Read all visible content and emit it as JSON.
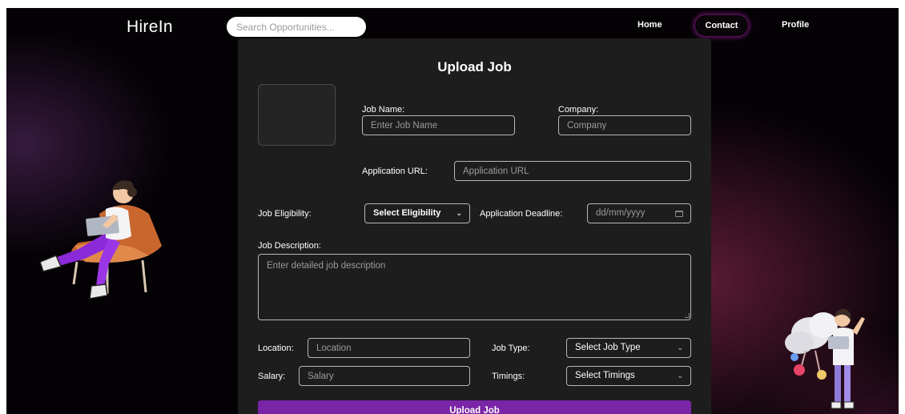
{
  "nav": {
    "logo": "HireIn",
    "search_placeholder": "Search Opportunities...",
    "links": {
      "home": "Home",
      "contact": "Contact",
      "profile": "Profile"
    }
  },
  "form": {
    "title": "Upload Job",
    "job_name": {
      "label": "Job Name:",
      "placeholder": "Enter Job Name"
    },
    "company": {
      "label": "Company:",
      "placeholder": "Company"
    },
    "application_url": {
      "label": "Application URL:",
      "placeholder": "Application URL"
    },
    "eligibility": {
      "label": "Job Eligibility:",
      "selected": "Select Eligibility"
    },
    "deadline": {
      "label": "Application Deadline:",
      "value": "dd/mm/yyyy"
    },
    "description": {
      "label": "Job Description:",
      "placeholder": "Enter detailed job description"
    },
    "location": {
      "label": "Location:",
      "placeholder": "Location"
    },
    "job_type": {
      "label": "Job Type:",
      "selected": "Select Job Type"
    },
    "salary": {
      "label": "Salary:",
      "placeholder": "Salary"
    },
    "timings": {
      "label": "Timings:",
      "selected": "Select Timings"
    },
    "submit_label": "Upload Job"
  },
  "icons": {
    "chevron": "chevron-down-icon",
    "calendar": "calendar-icon"
  },
  "colors": {
    "accent": "#7a24a6",
    "background": "#050205",
    "card": "#1d1d1e",
    "contact_glow": "#be28c8"
  }
}
